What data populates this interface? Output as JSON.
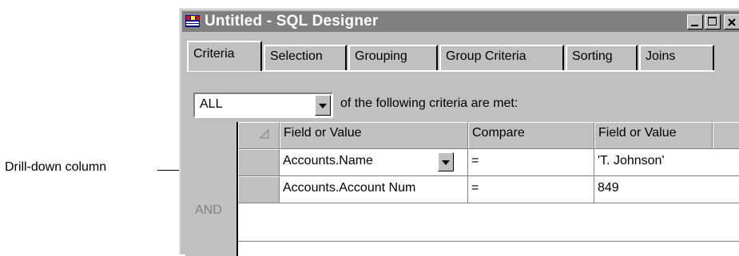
{
  "callout": {
    "label": "Drill-down column"
  },
  "window": {
    "title": "Untitled - SQL Designer",
    "controls": [
      "minimize-icon",
      "maximize-icon",
      "close-icon"
    ]
  },
  "tabs": [
    {
      "label": "Criteria",
      "active": true
    },
    {
      "label": "Selection",
      "active": false
    },
    {
      "label": "Grouping",
      "active": false
    },
    {
      "label": "Group Criteria",
      "active": false
    },
    {
      "label": "Sorting",
      "active": false
    },
    {
      "label": "Joins",
      "active": false
    }
  ],
  "criteria": {
    "match_value": "ALL",
    "suffix": "of the following criteria are met:"
  },
  "grid": {
    "columns": [
      "Field or Value",
      "Compare",
      "Field or Value"
    ],
    "rows": [
      {
        "field": "Accounts.Name",
        "compare": "=",
        "value": "'T. Johnson'"
      },
      {
        "field": "Accounts.Account Num",
        "compare": "=",
        "value": "849"
      }
    ],
    "connector": "AND"
  }
}
